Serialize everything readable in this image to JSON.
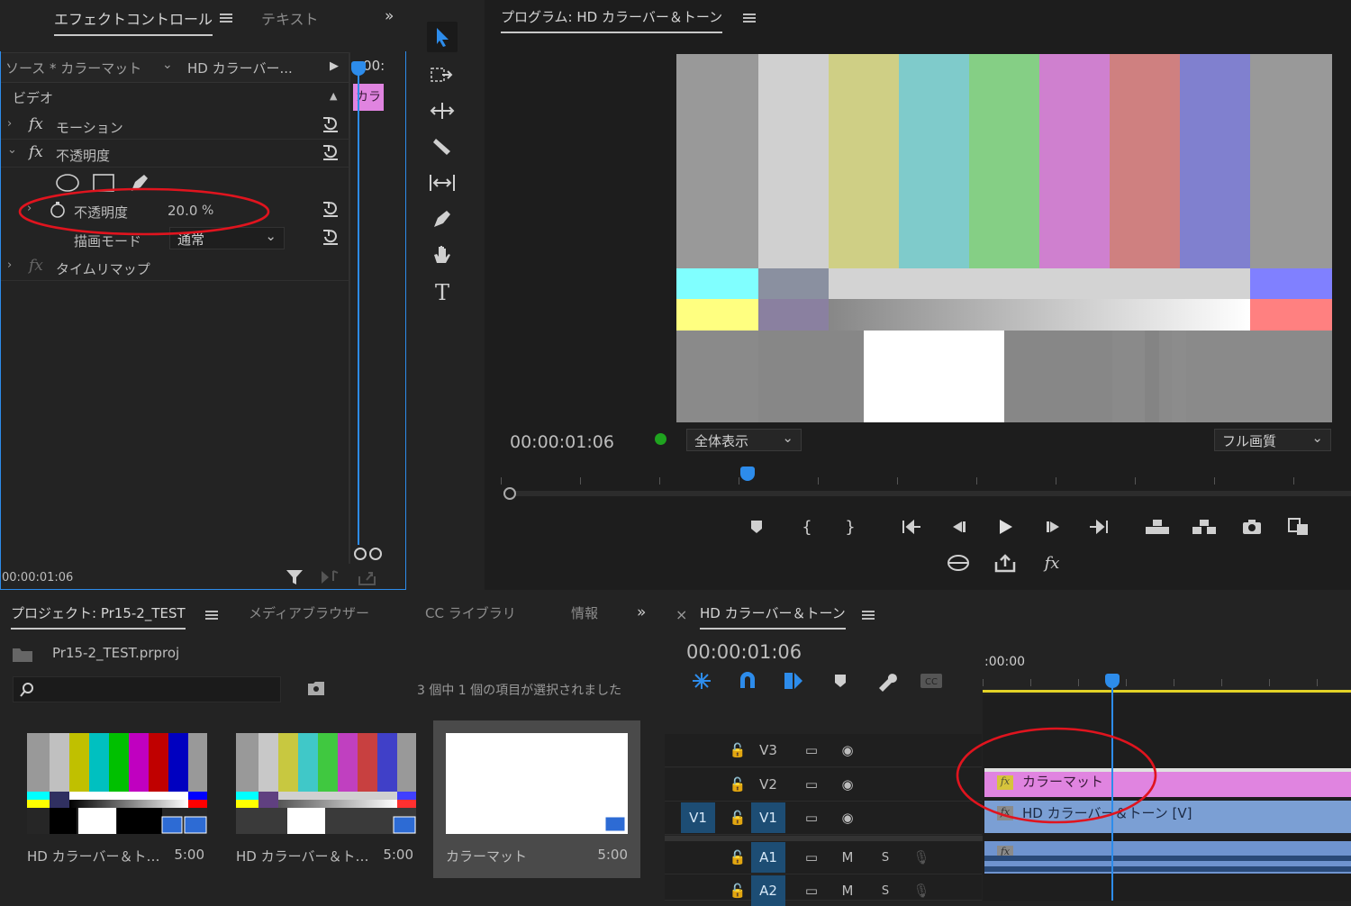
{
  "effects_panel": {
    "tab_effect_controls": "エフェクトコントロール",
    "tab_text": "テキスト",
    "source_label": "ソース * カラーマット",
    "sequence_label": "HD カラーバー...",
    "time_head": ":00:",
    "clip_label": "カラ",
    "section_video": "ビデオ",
    "motion": "モーション",
    "opacity_group": "不透明度",
    "opacity_param": "不透明度",
    "opacity_value": "20.0",
    "opacity_unit": "%",
    "blend_mode_label": "描画モード",
    "blend_mode_value": "通常",
    "time_remap": "タイムリマップ",
    "current_time": "00:00:01:06"
  },
  "program_monitor": {
    "title": "プログラム: HD カラーバー＆トーン",
    "timecode": "00:00:01:06",
    "zoom": "全体表示",
    "quality": "フル画質",
    "fx_button": "fx"
  },
  "project_panel": {
    "tab_project": "プロジェクト: Pr15-2_TEST",
    "tab_media_browser": "メディアブラウザー",
    "tab_cc_library": "CC ライブラリ",
    "tab_info": "情報",
    "file_name": "Pr15-2_TEST.prproj",
    "search_placeholder": "",
    "selection_status": "3 個中 1 個の項目が選択されました",
    "items": [
      {
        "name": "HD カラーバー＆ト…",
        "duration": "5:00"
      },
      {
        "name": "HD カラーバー＆ト…",
        "duration": "5:00"
      },
      {
        "name": "カラーマット",
        "duration": "5:00"
      }
    ]
  },
  "timeline": {
    "close": "×",
    "title": "HD カラーバー＆トーン",
    "timecode": "00:00:01:06",
    "ruler_start": ":00:00",
    "tracks": [
      {
        "source": "",
        "name": "V3",
        "toggle": "",
        "solo": ""
      },
      {
        "source": "",
        "name": "V2",
        "toggle": "",
        "solo": ""
      },
      {
        "source": "V1",
        "name": "V1",
        "toggle": "",
        "solo": ""
      },
      {
        "source": "",
        "name": "A1",
        "toggle": "M",
        "solo": "S"
      },
      {
        "source": "",
        "name": "A2",
        "toggle": "M",
        "solo": "S"
      }
    ],
    "clip_v2": "カラーマット",
    "clip_v1": "HD カラーバー＆トーン [V]",
    "clip_fx": "fx",
    "playhead_position": 0.35
  },
  "colors": {
    "accent": "#2d8ceb",
    "clip_pink": "#e084e0",
    "clip_blue": "#7b9fd4",
    "annotation": "#e0141e"
  }
}
